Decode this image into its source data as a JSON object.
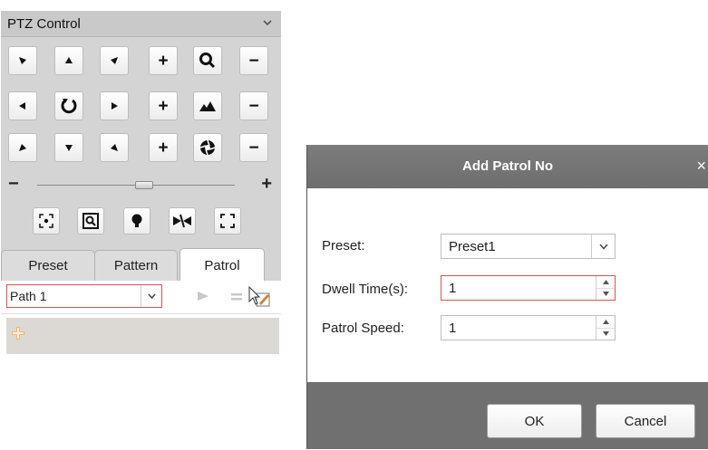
{
  "ptz": {
    "title": "PTZ Control",
    "direction_buttons": [
      "up-left",
      "up",
      "up-right",
      "left",
      "auto-rotate",
      "right",
      "down-left",
      "down",
      "down-right"
    ],
    "zoom_slider": {
      "minus": "−",
      "plus": "+",
      "value": 0.55
    },
    "plus_label": "+",
    "minus_label": "−",
    "function_buttons": [
      "3d-positioning-icon",
      "zoom-window-icon",
      "light-icon",
      "wiper-icon",
      "focus-frame-icon"
    ],
    "tabs": [
      {
        "label": "Preset",
        "active": false
      },
      {
        "label": "Pattern",
        "active": false
      },
      {
        "label": "Patrol",
        "active": true
      }
    ],
    "path_select": {
      "value": "Path 1"
    }
  },
  "dialog": {
    "title": "Add Patrol No",
    "close": "×",
    "preset_label": "Preset:",
    "preset_value": "Preset1",
    "dwell_label": "Dwell Time(s):",
    "dwell_value": "1",
    "speed_label": "Patrol Speed:",
    "speed_value": "1",
    "ok": "OK",
    "cancel": "Cancel"
  },
  "colors": {
    "panel_bg": "#d4d4d4",
    "header_bg": "#c9c9c9",
    "dialog_title_bg": "#777777",
    "focus_border": "#d9534f"
  }
}
